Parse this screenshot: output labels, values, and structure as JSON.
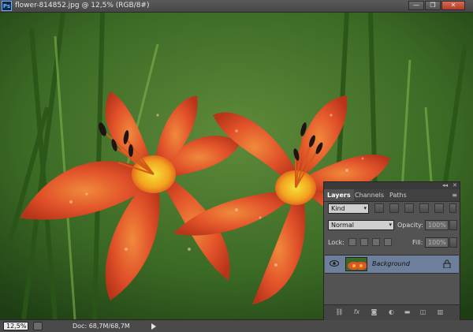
{
  "window": {
    "app_logo_text": "Ps",
    "title": "flower-814852.jpg @ 12,5% (RGB/8#)",
    "controls": {
      "minimize": "—",
      "restore": "❐",
      "close": "✕"
    }
  },
  "status": {
    "zoom": "12,5%",
    "doc": "Doc: 68,7M/68,7M"
  },
  "panel": {
    "dock_controls": {
      "collapse": "◂◂",
      "close": "✕"
    },
    "tabs": [
      {
        "label": "Layers",
        "active": true
      },
      {
        "label": "Channels",
        "active": false
      },
      {
        "label": "Paths",
        "active": false
      }
    ],
    "menu_icon": "≡",
    "filter": {
      "label": "Kind"
    },
    "blend": {
      "mode": "Normal",
      "opacity_label": "Opacity:",
      "opacity_value": "100%"
    },
    "lock": {
      "label": "Lock:",
      "fill_label": "Fill:",
      "fill_value": "100%"
    },
    "layers": [
      {
        "name": "Background",
        "visible": true,
        "locked": true
      }
    ],
    "bottom_icons": [
      "link-icon",
      "fx-icon",
      "mask-icon",
      "adjustment-icon",
      "group-icon",
      "new-layer-icon",
      "trash-icon"
    ]
  },
  "colors": {
    "ui_dark": "#3c3c3c",
    "panel": "#535353",
    "selected_layer": "#6d7f9a",
    "flower_orange": "#e2532a",
    "foliage": "#2e5a1e"
  }
}
